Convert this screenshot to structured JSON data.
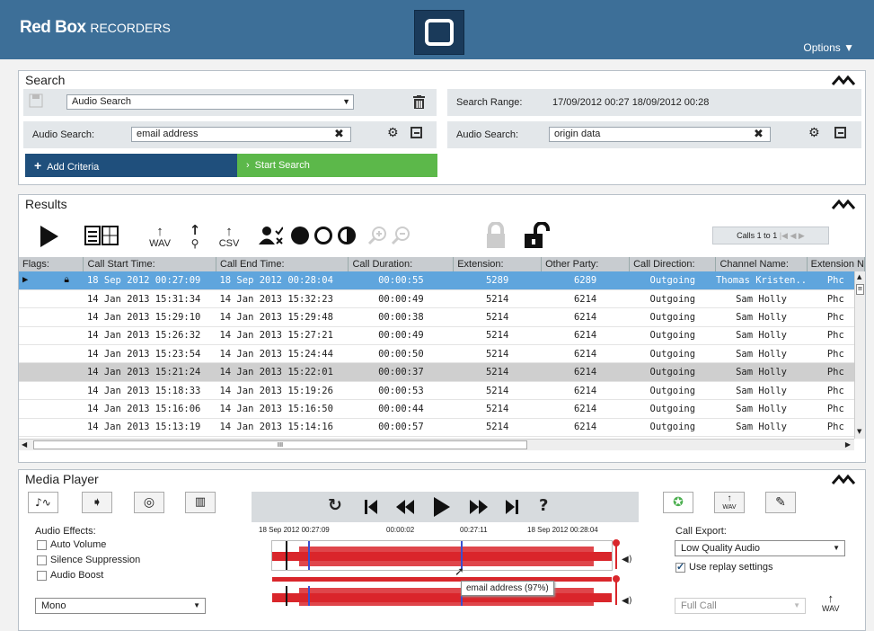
{
  "header": {
    "brand": "Red Box",
    "brand_sub": "RECORDERS",
    "options_label": "Options ▼"
  },
  "search": {
    "title": "Search",
    "saved_search": "Audio Search",
    "range_label": "Search Range:",
    "range_value": "17/09/2012 00:27  18/09/2012 00:28",
    "criteria": [
      {
        "label": "Audio Search:",
        "value": "email address"
      },
      {
        "label": "Audio Search:",
        "value": "origin data"
      }
    ],
    "add_criteria": "Add Criteria",
    "start_search": "Start Search"
  },
  "results": {
    "title": "Results",
    "pager_text": "Calls 1 to 1",
    "toolbar": {
      "wav": "WAV",
      "csv": "CSV"
    },
    "columns": [
      "Flags:",
      "Call Start Time:",
      "Call End Time:",
      "Call Duration:",
      "Extension:",
      "Other Party:",
      "Call Direction:",
      "Channel Name:",
      "Extension N"
    ],
    "rows": [
      [
        "18 Sep 2012 00:27:09",
        "18 Sep 2012 00:28:04",
        "00:00:55",
        "5289",
        "6289",
        "Outgoing",
        "Thomas Kristen..",
        "Phc"
      ],
      [
        "14 Jan 2013 15:31:34",
        "14 Jan 2013 15:32:23",
        "00:00:49",
        "5214",
        "6214",
        "Outgoing",
        "Sam Holly",
        "Phc"
      ],
      [
        "14 Jan 2013 15:29:10",
        "14 Jan 2013 15:29:48",
        "00:00:38",
        "5214",
        "6214",
        "Outgoing",
        "Sam Holly",
        "Phc"
      ],
      [
        "14 Jan 2013 15:26:32",
        "14 Jan 2013 15:27:21",
        "00:00:49",
        "5214",
        "6214",
        "Outgoing",
        "Sam Holly",
        "Phc"
      ],
      [
        "14 Jan 2013 15:23:54",
        "14 Jan 2013 15:24:44",
        "00:00:50",
        "5214",
        "6214",
        "Outgoing",
        "Sam Holly",
        "Phc"
      ],
      [
        "14 Jan 2013 15:21:24",
        "14 Jan 2013 15:22:01",
        "00:00:37",
        "5214",
        "6214",
        "Outgoing",
        "Sam Holly",
        "Phc"
      ],
      [
        "14 Jan 2013 15:18:33",
        "14 Jan 2013 15:19:26",
        "00:00:53",
        "5214",
        "6214",
        "Outgoing",
        "Sam Holly",
        "Phc"
      ],
      [
        "14 Jan 2013 15:16:06",
        "14 Jan 2013 15:16:50",
        "00:00:44",
        "5214",
        "6214",
        "Outgoing",
        "Sam Holly",
        "Phc"
      ],
      [
        "14 Jan 2013 15:13:19",
        "14 Jan 2013 15:14:16",
        "00:00:57",
        "5214",
        "6214",
        "Outgoing",
        "Sam Holly",
        "Phc"
      ]
    ],
    "scroll_grip": "III"
  },
  "media": {
    "title": "Media Player",
    "effects_label": "Audio Effects:",
    "effects": [
      "Auto Volume",
      "Silence Suppression",
      "Audio Boost"
    ],
    "channel_mode": "Mono",
    "timeline": {
      "start": "18 Sep 2012 00:27:09",
      "elapsed": "00:00:02",
      "marker": "00:27:11",
      "end": "18 Sep 2012 00:28:04"
    },
    "tooltip": "email address (97%)",
    "export_label": "Call Export:",
    "export_quality": "Low Quality Audio",
    "use_replay": "Use replay settings",
    "export_scope": "Full Call",
    "wav": "WAV",
    "help": "?"
  }
}
